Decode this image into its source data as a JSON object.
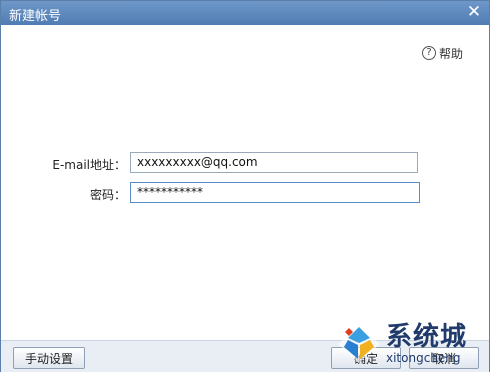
{
  "window": {
    "title": "新建帐号",
    "close_glyph": "✕"
  },
  "help": {
    "icon_glyph": "?",
    "label": "帮助"
  },
  "form": {
    "email_label": "E-mail地址：",
    "email_value": "xxxxxxxxx@qq.com",
    "password_label": "密码：",
    "password_value": "***********"
  },
  "footer": {
    "manual_settings_label": "手动设置",
    "ok_label": "确定",
    "cancel_label": "取消"
  },
  "watermark": {
    "text_cn": "系统城",
    "text_en": "xitongcheng"
  }
}
